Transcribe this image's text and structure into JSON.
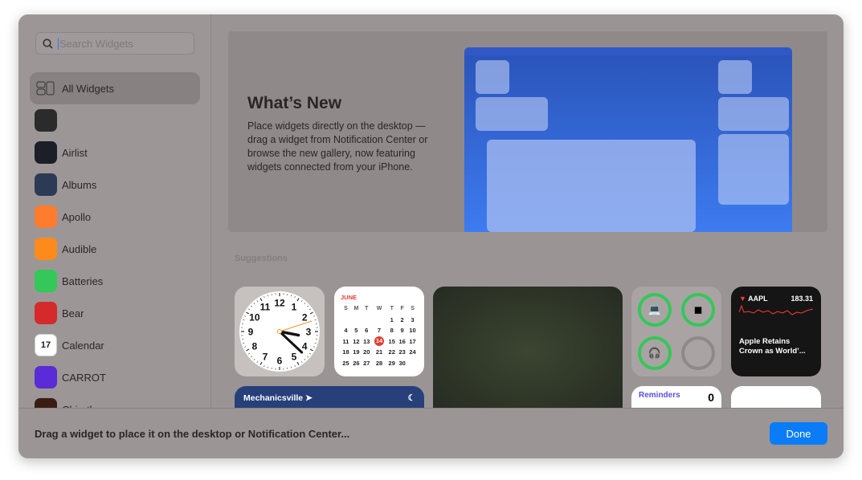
{
  "sidebar": {
    "search_placeholder": "Search Widgets",
    "items": [
      {
        "label": "All Widgets",
        "icon": "widgets-grid-icon",
        "color": ""
      },
      {
        "label": "",
        "icon": "dark-app-icon",
        "color": "#2b2b2b"
      },
      {
        "label": "Airlist",
        "icon": "airlist-icon",
        "color": "#1c1f28"
      },
      {
        "label": "Albums",
        "icon": "albums-icon",
        "color": "#2d3a55"
      },
      {
        "label": "Apollo",
        "icon": "apollo-icon",
        "color": "#ff7b2e"
      },
      {
        "label": "Audible",
        "icon": "audible-icon",
        "color": "#ff8a1c"
      },
      {
        "label": "Batteries",
        "icon": "batteries-icon",
        "color": "#34c759"
      },
      {
        "label": "Bear",
        "icon": "bear-icon",
        "color": "#d42a2a"
      },
      {
        "label": "Calendar",
        "icon": "calendar-icon",
        "color": "#ffffff"
      },
      {
        "label": "CARROT",
        "icon": "carrot-icon",
        "color": "#5a2bd6"
      },
      {
        "label": "Chirpth...",
        "icon": "chirp-icon",
        "color": "#3a1d12"
      }
    ]
  },
  "hero": {
    "title": "What’s New",
    "body": "Place widgets directly on the desktop — drag a widget from Notification Center or browse the new gallery, now featuring widgets connected from your iPhone."
  },
  "suggestions_label": "Suggestions",
  "clock": {
    "numbers": [
      "12",
      "1",
      "2",
      "3",
      "4",
      "5",
      "6",
      "7",
      "8",
      "9",
      "10",
      "11"
    ],
    "hours": 3,
    "minutes": 22,
    "seconds": 12
  },
  "calendar": {
    "month": "JUNE",
    "weekdays": [
      "S",
      "M",
      "T",
      "W",
      "T",
      "F",
      "S"
    ],
    "weeks": [
      [
        "",
        "",
        "",
        "",
        "1",
        "2",
        "3"
      ],
      [
        "4",
        "5",
        "6",
        "7",
        "8",
        "9",
        "10"
      ],
      [
        "11",
        "12",
        "13",
        "14",
        "15",
        "16",
        "17"
      ],
      [
        "18",
        "19",
        "20",
        "21",
        "22",
        "23",
        "24"
      ],
      [
        "25",
        "26",
        "27",
        "28",
        "29",
        "30",
        ""
      ]
    ],
    "today": "14",
    "accent": "#e63b30"
  },
  "stocks": {
    "symbol": "AAPL",
    "price": "183.31",
    "headline": "Apple Retains Crown as World’..."
  },
  "weather": {
    "location": "Mechanicsville"
  },
  "reminders": {
    "title": "Reminders",
    "count": "0"
  },
  "footer": {
    "message": "Drag a widget to place it on the desktop or Notification Center...",
    "done_label": "Done",
    "accent": "#0a7cf7"
  }
}
